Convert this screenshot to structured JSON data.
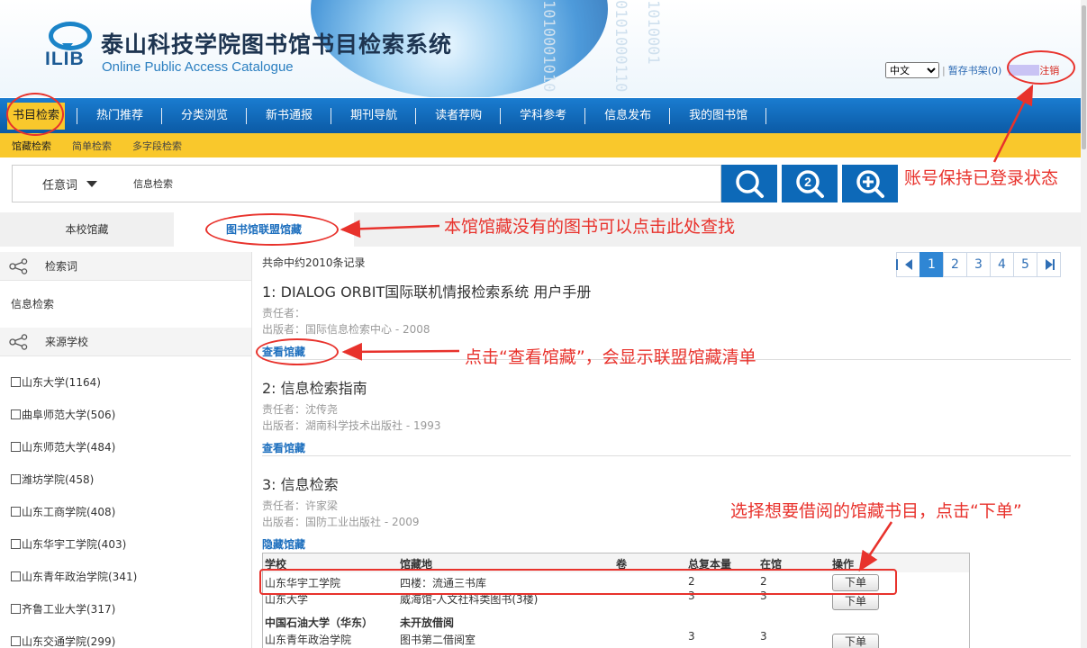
{
  "header": {
    "logo_text": "ILIB",
    "title": "泰山科技学院图书馆书目检索系统",
    "subtitle": "Online Public Access Catalogue",
    "language": "中文",
    "cart_link": "暂存书架(0)",
    "logout": "注销"
  },
  "nav": {
    "items": [
      "书目检索",
      "热门推荐",
      "分类浏览",
      "新书通报",
      "期刊导航",
      "读者荐购",
      "学科参考",
      "信息发布",
      "我的图书馆"
    ],
    "sub_items": [
      "馆藏检索",
      "简单检索",
      "多字段检索"
    ]
  },
  "search": {
    "type": "任意词",
    "value": "信息检索"
  },
  "tabs": {
    "local": "本校馆藏",
    "union": "图书馆联盟馆藏"
  },
  "sidebar": {
    "keyword_heading": "检索词",
    "keyword": "信息检索",
    "school_heading": "来源学校",
    "schools": [
      "山东大学(1164)",
      "曲阜师范大学(506)",
      "山东师范大学(484)",
      "潍坊学院(458)",
      "山东工商学院(408)",
      "山东华宇工学院(403)",
      "山东青年政治学院(341)",
      "齐鲁工业大学(317)",
      "山东交通学院(299)"
    ]
  },
  "results": {
    "count_text": "共命中约2010条记录",
    "pages": [
      "1",
      "2",
      "3",
      "4",
      "5"
    ],
    "current_page": "1",
    "records": [
      {
        "title": "1: DIALOG ORBIT国际联机情报检索系统 用户手册",
        "author": "责任者：",
        "publisher": "出版者：国际信息检索中心 - 2008",
        "link": "查看馆藏"
      },
      {
        "title": "2: 信息检索指南",
        "author": "责任者：沈传尧",
        "publisher": "出版者：湖南科学技术出版社 - 1993",
        "link": "查看馆藏"
      },
      {
        "title": "3: 信息检索",
        "author": "责任者：许家梁",
        "publisher": "出版者：国防工业出版社 - 2009",
        "link": "隐藏馆藏"
      }
    ],
    "holdings": {
      "headers": [
        "学校",
        "馆藏地",
        "卷",
        "总复本量",
        "在馆",
        "操作"
      ],
      "rows": [
        {
          "school": "山东华宇工学院",
          "location": "四楼：流通三书库",
          "vol": "",
          "total": "2",
          "avail": "2",
          "action": "下单"
        },
        {
          "school": "山东大学",
          "location": "威海馆-人文社科类图书(3楼)",
          "vol": "",
          "total": "3",
          "avail": "3",
          "action": "下单"
        },
        {
          "school": "中国石油大学（华东）",
          "location": "未开放借阅",
          "vol": "",
          "total": "",
          "avail": "",
          "action": ""
        },
        {
          "school": "山东青年政治学院",
          "location": "图书第二借阅室",
          "vol": "",
          "total": "3",
          "avail": "3",
          "action": "下单"
        }
      ]
    }
  },
  "annotations": {
    "login": "账号保持已登录状态",
    "union": "本馆馆藏没有的图书可以点击此处查找",
    "view": "点击“查看馆藏”，会显示联盟馆藏清单",
    "order": "选择想要借阅的馆藏书目，点击“下单”"
  },
  "colors": {
    "nav_blue": "#0d69b8",
    "accent_yellow": "#f9c82c",
    "annotation_red": "#e8322c",
    "link_blue": "#1d6fbe"
  }
}
